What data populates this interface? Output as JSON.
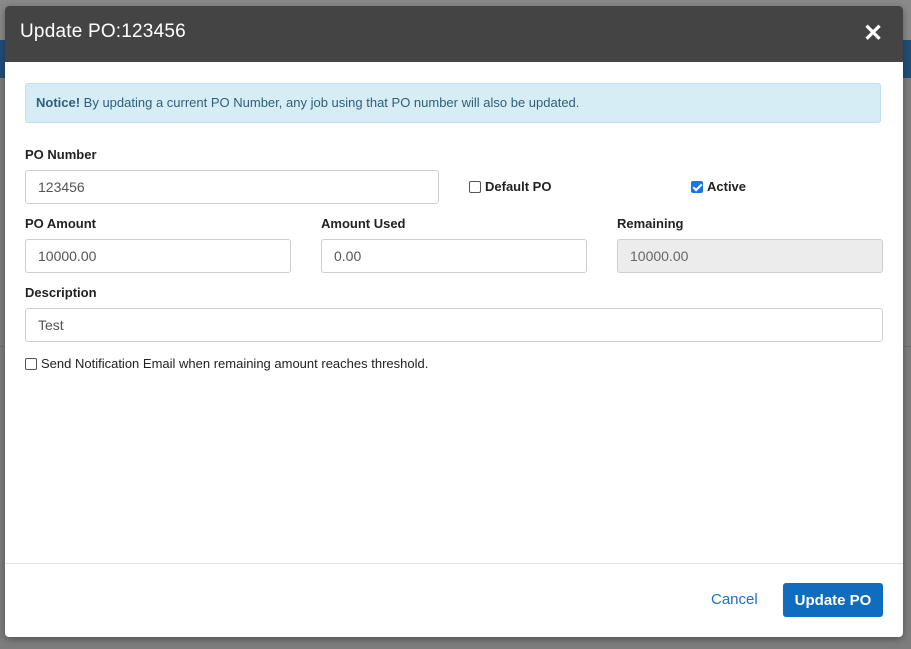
{
  "modal": {
    "title": "Update PO:123456",
    "close_glyph": "✕"
  },
  "notice": {
    "strong": "Notice!",
    "text": " By updating a current PO Number, any job using that PO number will also be updated."
  },
  "form": {
    "po_number": {
      "label": "PO Number",
      "value": "123456"
    },
    "default_po": {
      "label": "Default PO",
      "checked": false
    },
    "active": {
      "label": "Active",
      "checked": true
    },
    "po_amount": {
      "label": "PO Amount",
      "value": "10000.00"
    },
    "amount_used": {
      "label": "Amount Used",
      "value": "0.00"
    },
    "remaining": {
      "label": "Remaining",
      "value": "10000.00"
    },
    "description": {
      "label": "Description",
      "value": "Test"
    },
    "notify": {
      "label": "Send Notification Email when remaining amount reaches threshold.",
      "checked": false
    }
  },
  "footer": {
    "cancel_label": "Cancel",
    "update_label": "Update PO"
  },
  "colors": {
    "header_bg": "#444444",
    "primary": "#0f6dbf",
    "notice_bg": "#d6edf5"
  }
}
